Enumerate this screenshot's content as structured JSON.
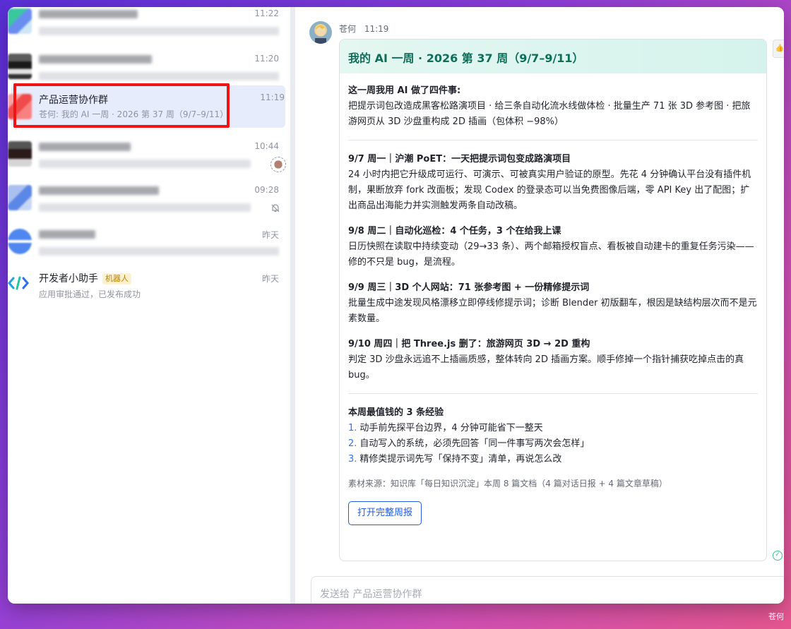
{
  "sidebar": {
    "items": [
      {
        "title": "",
        "time": "11:22",
        "preview": ""
      },
      {
        "title": "",
        "time": "11:20",
        "preview": ""
      },
      {
        "title": "产品运营协作群",
        "time": "11:19",
        "preview": "苍何: 我的 AI 一周 · 2026 第 37 周（9/7–9/11）"
      },
      {
        "title": "",
        "time": "10:44",
        "preview": ""
      },
      {
        "title": "",
        "time": "09:28",
        "preview": ""
      },
      {
        "title": "",
        "time": "昨天",
        "preview": ""
      },
      {
        "title": "开发者小助手",
        "tag": "机器人",
        "time": "昨天",
        "preview": "应用审批通过，已发布成功"
      }
    ]
  },
  "message": {
    "sender": "苍何",
    "time": "11:19",
    "card": {
      "header": "我的 AI 一周 · 2026 第 37 周（9/7–9/11）",
      "summary_title": "这一周我用 AI 做了四件事:",
      "summary_body": "把提示词包改造成黑客松路演项目 · 给三条自动化流水线做体检 · 批量生产 71 张 3D 参考图 · 把旅游网页从 3D 沙盘重构成 2D 插画（包体积 −98%）",
      "days": [
        {
          "title": "9/7 周一｜沪潮 PoET：一天把提示词包变成路演项目",
          "body": "24 小时内把它升级成可运行、可演示、可被真实用户验证的原型。先花 4 分钟确认平台没有插件机制，果断放弃 fork 改面板；发现 Codex 的登录态可以当免费图像后端，零 API Key 出了配图；扩出商品出海能力并实测触发两条自动改稿。"
        },
        {
          "title": "9/8 周二｜自动化巡检：4 个任务，3 个在给我上课",
          "body": "日历快照在读取中持续变动（29→33 条）、两个邮箱授权盲点、看板被自动建卡的重复任务污染——修的不只是 bug，是流程。"
        },
        {
          "title": "9/9 周三｜3D 个人网站：71 张参考图 + 一份精修提示词",
          "body": "批量生成中途发现风格漂移立即停线修提示词；诊断 Blender 初版翻车，根因是缺结构层次而不是元素数量。"
        },
        {
          "title": "9/10 周四｜把 Three.js 删了：旅游网页 3D → 2D 重构",
          "body": "判定 3D 沙盘永远追不上插画质感，整体转向 2D 插画方案。顺手修掉一个指针捕获吃掉点击的真 bug。"
        }
      ],
      "lessons_title": "本周最值钱的 3 条经验",
      "lessons": [
        {
          "num": "1.",
          "text": "动手前先探平台边界，4 分钟可能省下一整天"
        },
        {
          "num": "2.",
          "text": "自动写入的系统，必须先回答「同一件事写两次会怎样」"
        },
        {
          "num": "3.",
          "text": "精修类提示词先写「保持不变」清单，再说怎么改"
        }
      ],
      "source": "素材来源：知识库「每日知识沉淀」本周 8 篇文档（4 篇对话日报 + 4 篇文章草稿）",
      "button": "打开完整周报"
    }
  },
  "input": {
    "placeholder": "发送给 产品运营协作群"
  },
  "dock": {
    "label": "苍何"
  }
}
